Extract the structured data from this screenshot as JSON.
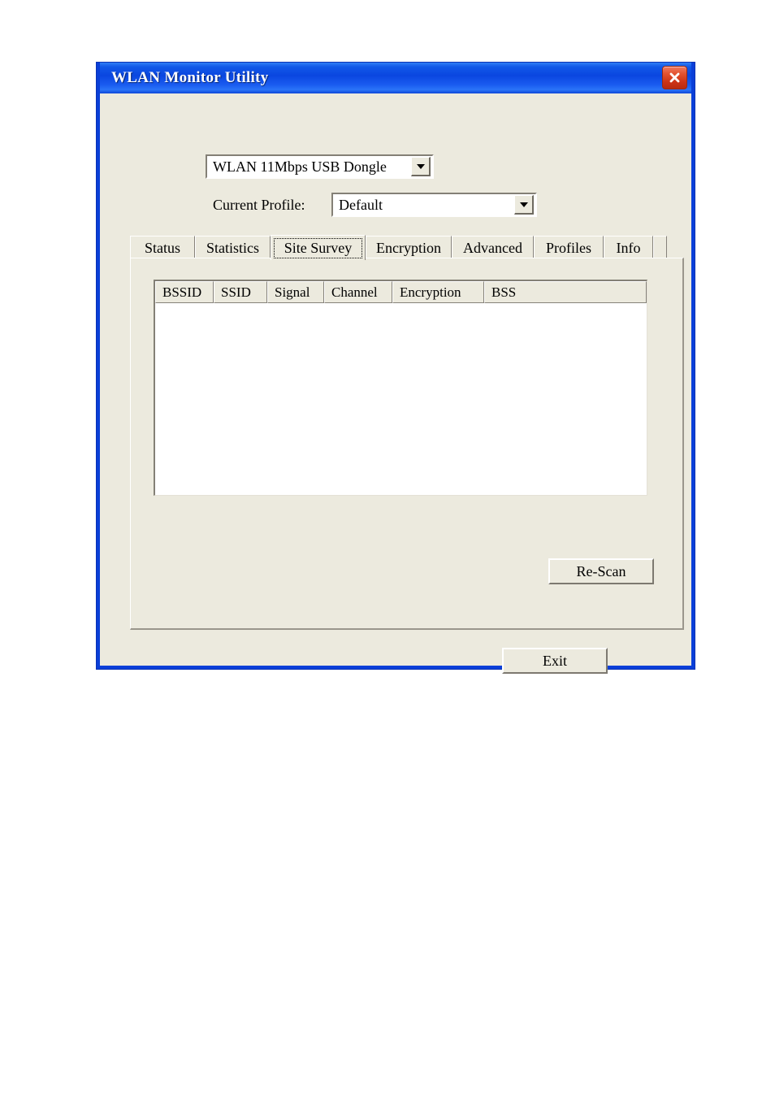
{
  "window": {
    "title": "WLAN Monitor Utility",
    "close_icon": "close-icon",
    "titlebar_color": "#0a46e0",
    "client_color": "#eceade"
  },
  "adapter": {
    "selected": "WLAN 11Mbps USB Dongle",
    "arrow_icon": "chevron-down-icon"
  },
  "profile": {
    "label": "Current Profile:",
    "selected": "Default",
    "arrow_icon": "chevron-down-icon"
  },
  "tabs": [
    {
      "label": "Status",
      "selected": false
    },
    {
      "label": "Statistics",
      "selected": false
    },
    {
      "label": "Site Survey",
      "selected": true
    },
    {
      "label": "Encryption",
      "selected": false
    },
    {
      "label": "Advanced",
      "selected": false
    },
    {
      "label": "Profiles",
      "selected": false
    },
    {
      "label": "Info",
      "selected": false
    }
  ],
  "site_survey": {
    "columns": [
      "BSSID",
      "SSID",
      "Signal",
      "Channel",
      "Encryption",
      "BSS"
    ],
    "rows": [],
    "rescan_label": "Re-Scan"
  },
  "footer": {
    "exit_label": "Exit"
  }
}
